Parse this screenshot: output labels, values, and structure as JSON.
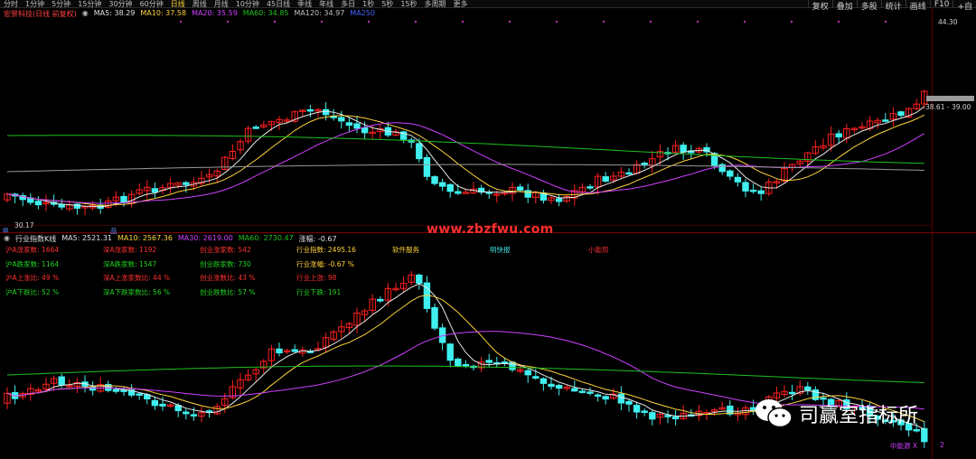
{
  "toolbar": {
    "tabs": [
      "分时",
      "1分钟",
      "5分钟",
      "15分钟",
      "30分钟",
      "60分钟",
      "日线",
      "周线",
      "月线",
      "10分钟",
      "45日线",
      "季线",
      "年线",
      "多日",
      "1秒",
      "5秒",
      "15秒",
      "多周期",
      "更多"
    ],
    "active_tab": "日线",
    "tools": [
      "复权",
      "叠加",
      "多股",
      "统计",
      "画线",
      "F10",
      "+自"
    ]
  },
  "upper": {
    "stock_name": "宏景科技(日线 前复权)",
    "ma": [
      {
        "label": "MA5: 38.29",
        "color": "#e0e0e0"
      },
      {
        "label": "MA10: 37.58",
        "color": "#ffd23a"
      },
      {
        "label": "MA20: 35.59",
        "color": "#d040ff"
      },
      {
        "label": "MA60: 34.85",
        "color": "#20c020"
      },
      {
        "label": "MA120: 34.97",
        "color": "#c0c0c0"
      },
      {
        "label": "MA250",
        "color": "#4060ff"
      }
    ],
    "high_label": "44.30",
    "low_label": "30.17",
    "price_label": "38.61 - 39.00",
    "bottom_markers": [
      "⊞",
      "品"
    ]
  },
  "lower": {
    "index_name": "行业指数K线",
    "ma": [
      {
        "label": "MA5: 2521.31",
        "color": "#e0e0e0"
      },
      {
        "label": "MA10: 2567.36",
        "color": "#ffd23a"
      },
      {
        "label": "MA30: 2619.00",
        "color": "#d040ff"
      },
      {
        "label": "MA60: 2730.47",
        "color": "#20c020"
      },
      {
        "label": "涨幅: -0.67",
        "color": "#e0e0e0"
      }
    ],
    "stats": [
      {
        "text": "沪A涨家数: 1664",
        "color": "#ff3030"
      },
      {
        "text": "沪A跌家数: 1164",
        "color": "#20d020"
      },
      {
        "text": "沪A上涨比: 49 %",
        "color": "#ff3030"
      },
      {
        "text": "沪A下跌比: 52 %",
        "color": "#20d020"
      },
      {
        "text": "深A涨家数: 1192",
        "color": "#ff3030"
      },
      {
        "text": "深A跌家数: 1547",
        "color": "#20d020"
      },
      {
        "text": "深A上涨家数比: 44 %",
        "color": "#ff3030"
      },
      {
        "text": "深A下跌家数比: 56 %",
        "color": "#20d020"
      },
      {
        "text": "创业涨家数: 542",
        "color": "#ff3030"
      },
      {
        "text": "创业跌家数: 730",
        "color": "#20d020"
      },
      {
        "text": "创业涨数比: 43 %",
        "color": "#ff3030"
      },
      {
        "text": "创业跌数比: 57 %",
        "color": "#20d020"
      },
      {
        "text": "行业指数: 2495.16",
        "color": "#ffd23a"
      },
      {
        "text": "行业涨幅: -0.67 %",
        "color": "#ffd23a"
      },
      {
        "text": "行业上涨: 98",
        "color": "#ff3030"
      },
      {
        "text": "行业下跌: 191",
        "color": "#20d020"
      }
    ],
    "sector_tags": [
      {
        "text": "软件服务",
        "color": "#ffd23a"
      },
      {
        "text": "明快报",
        "color": "#40e0e0"
      },
      {
        "text": "小能现",
        "color": "#ff3030"
      }
    ],
    "bottom_label": "中能源 X",
    "bottom_label2": "2"
  },
  "watermark": "www.zbzfwu.com",
  "brand": "司赢室指标所",
  "colors": {
    "up": "#ff2020",
    "down": "#40f0f0",
    "bg": "#000000",
    "grid": "#5a0000"
  }
}
